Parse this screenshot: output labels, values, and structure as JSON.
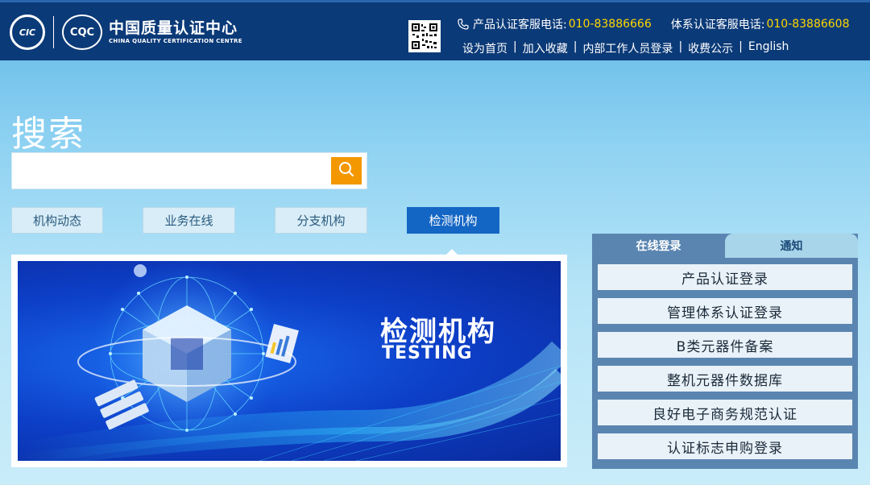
{
  "header": {
    "logo_cic": "CIC",
    "logo_cqc": "CQC",
    "org_name_cn": "中国质量认证中心",
    "org_name_en": "CHINA QUALITY CERTIFICATION CENTRE",
    "hotline_product_label": "产品认证客服电话:",
    "hotline_product_number": "010-83886666",
    "hotline_system_label": "体系认证客服电话:",
    "hotline_system_number": "010-83886608",
    "nav": [
      "设为首页",
      "加入收藏",
      "内部工作人员登录",
      "收费公示",
      "English"
    ]
  },
  "search": {
    "title": "搜索",
    "value": "",
    "placeholder": ""
  },
  "tabs": [
    "机构动态",
    "业务在线",
    "分支机构",
    "检测机构"
  ],
  "active_tab_index": 3,
  "banner": {
    "title": "检测机构",
    "subtitle": "TESTING"
  },
  "panel": {
    "tab_login": "在线登录",
    "tab_notice": "通知",
    "items": [
      "产品认证登录",
      "管理体系认证登录",
      "B类元器件备案",
      "整机元器件数据库",
      "良好电子商务规范认证",
      "认证标志申购登录"
    ]
  },
  "colors": {
    "header_bg": "#0b3a78",
    "accent_yellow": "#ffd800",
    "search_button": "#f39800",
    "active_tab": "#1466c4"
  }
}
